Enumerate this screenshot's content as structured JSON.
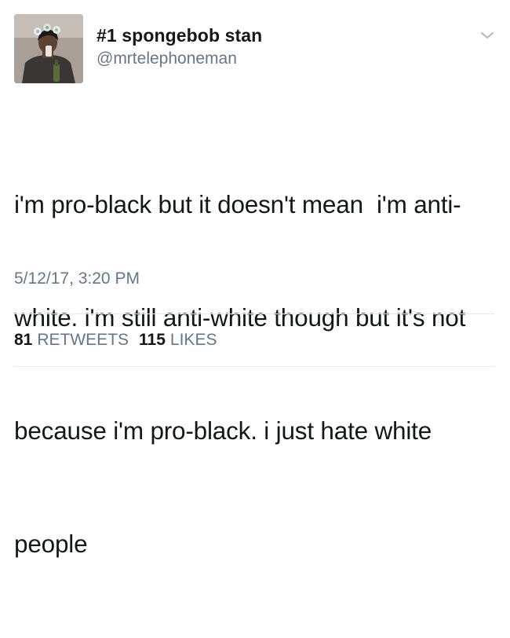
{
  "tweet": {
    "display_name": "#1 spongebob stan",
    "handle": "@mrtelephoneman",
    "text_lines": [
      "i'm pro-black but it doesn't mean  i'm anti-",
      "white. i'm still anti-white though but it's not",
      "because i'm pro-black. i just hate white",
      "people"
    ],
    "timestamp": "5/12/17, 3:20 PM",
    "retweets": {
      "count": "81",
      "label": "RETWEETS"
    },
    "likes": {
      "count": "115",
      "label": "LIKES"
    }
  },
  "icons": {
    "menu": "chevron-down-icon"
  },
  "colors": {
    "text": "#14171a",
    "secondary_text": "#657786",
    "divider": "#e6ecf0"
  }
}
